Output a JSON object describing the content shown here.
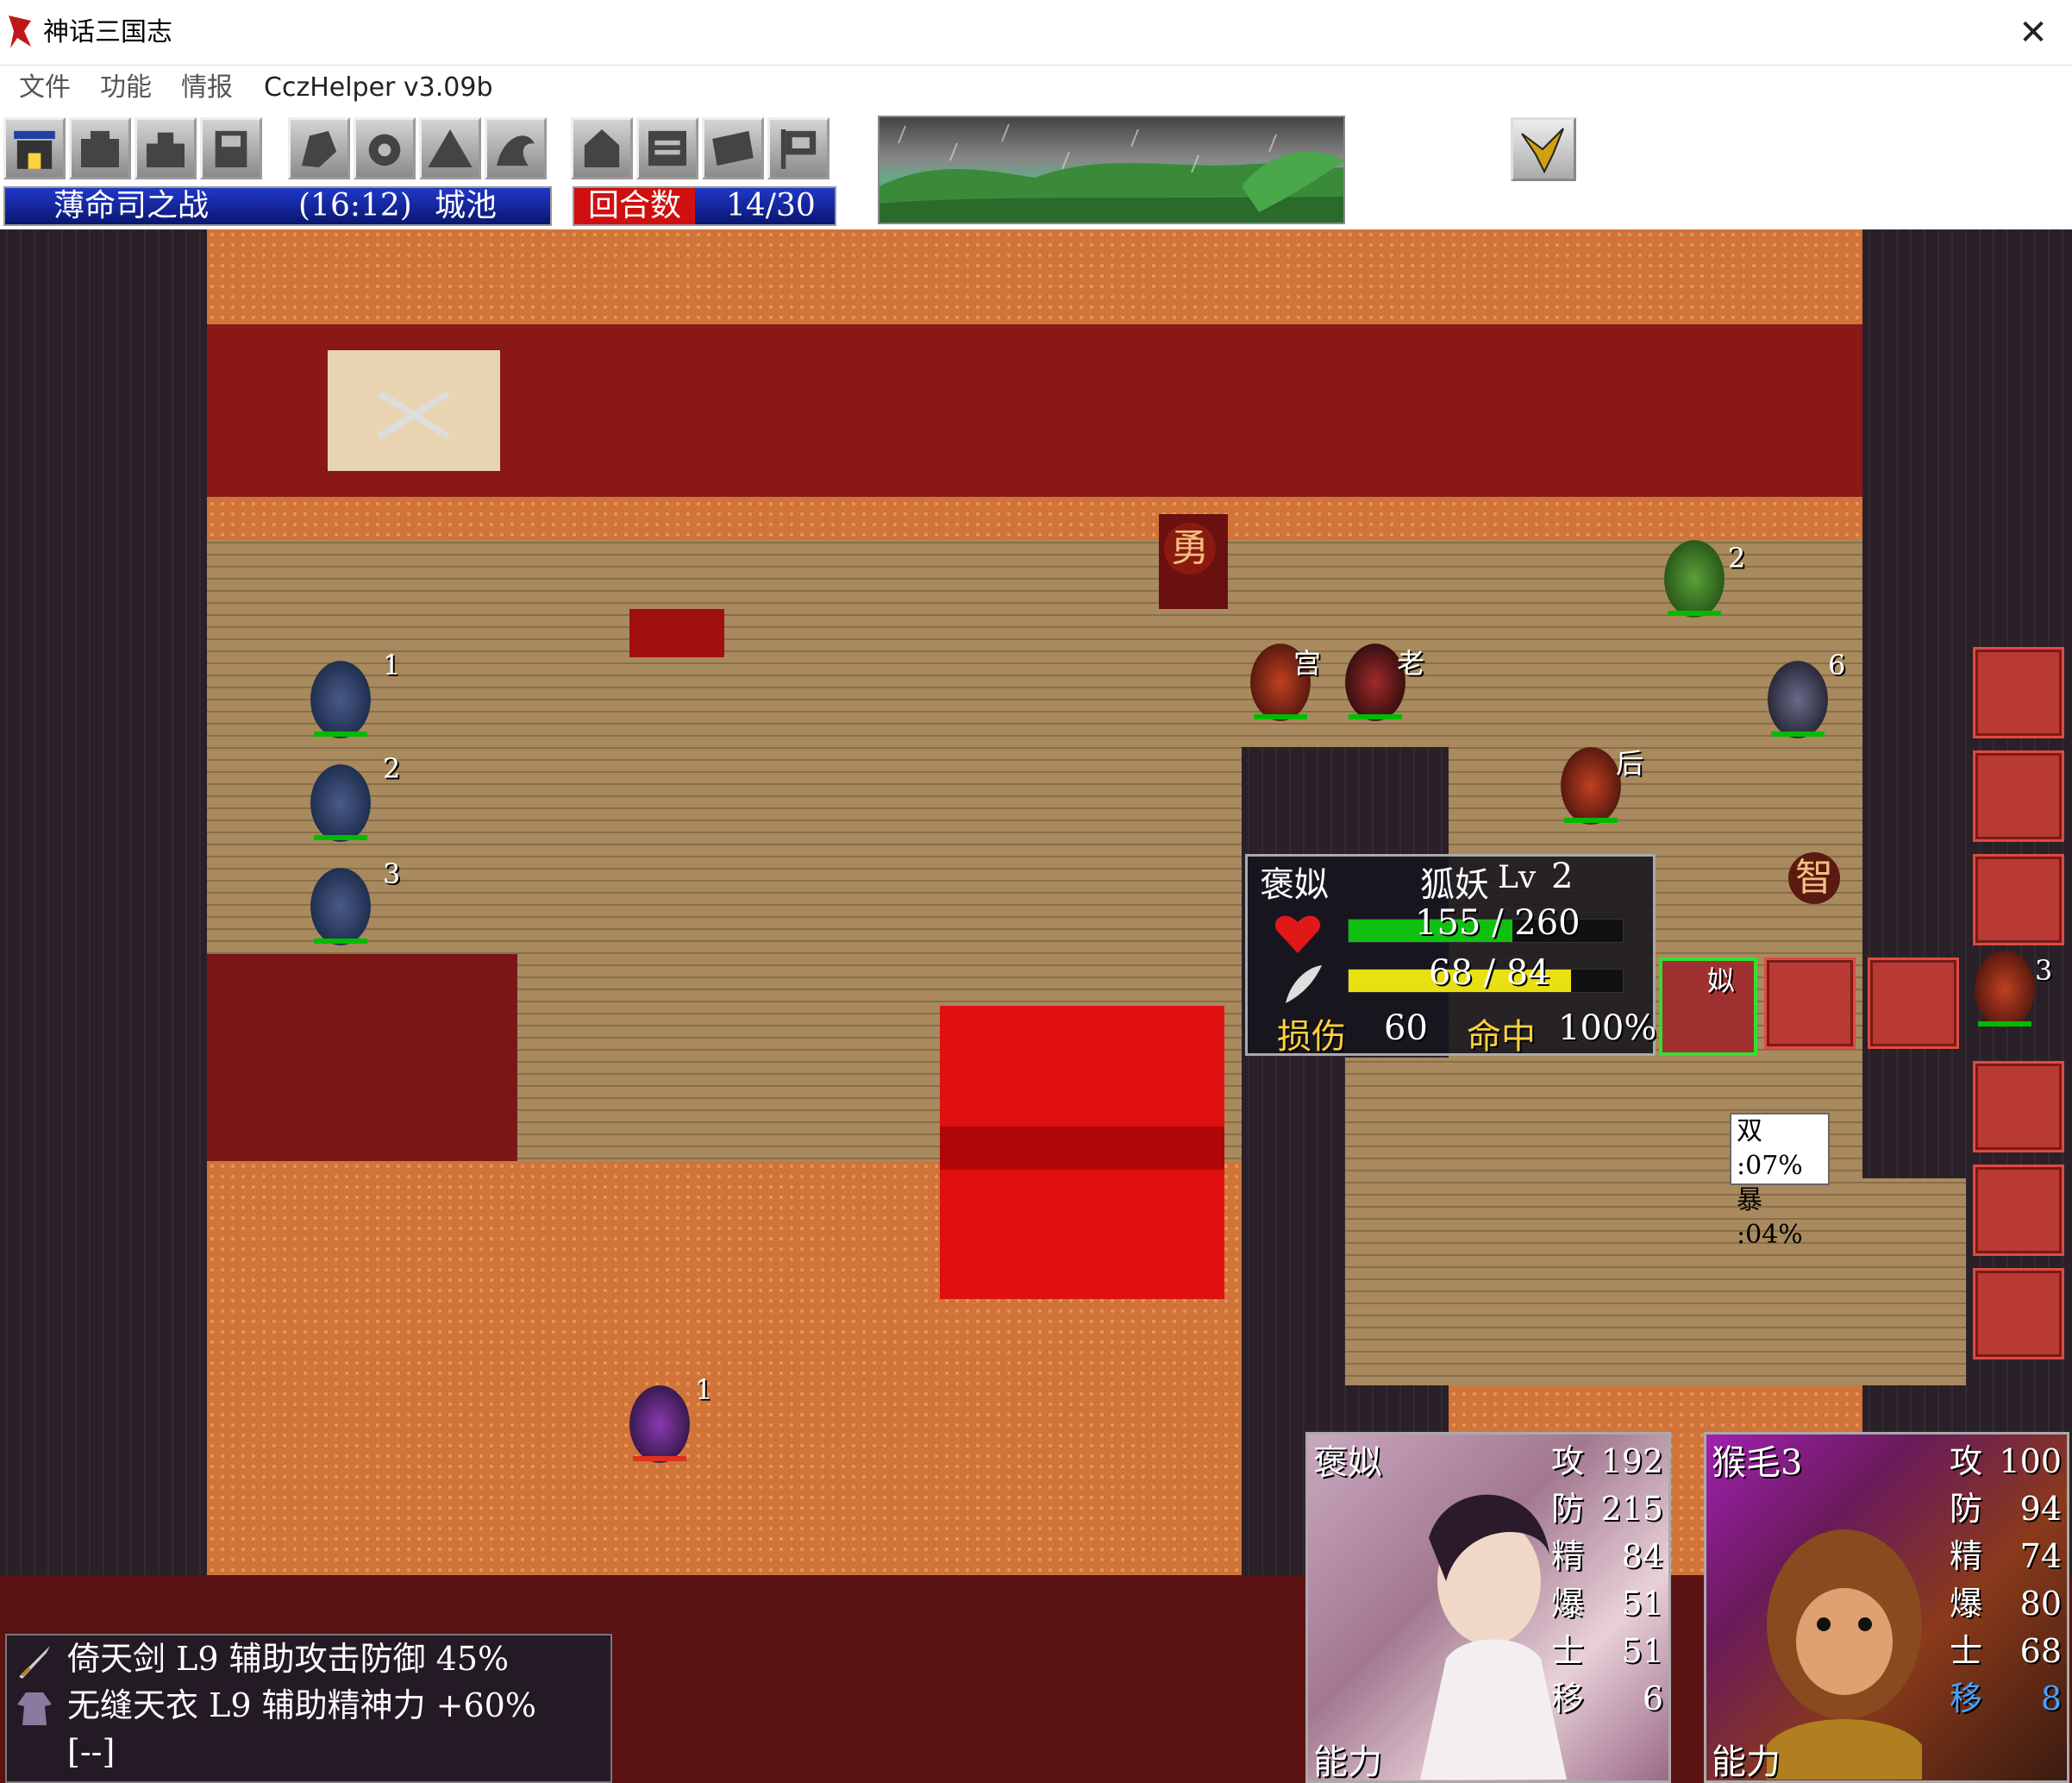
{
  "window": {
    "title": "神话三国志",
    "close_glyph": "✕"
  },
  "menu": [
    {
      "label": "文件"
    },
    {
      "label": "功能"
    },
    {
      "label": "情报"
    },
    {
      "label": "CczHelper v3.09b"
    }
  ],
  "toolbar": {
    "icons": [
      "castle-icon",
      "command-icon",
      "command2-icon",
      "save-icon",
      "unit-icon",
      "strategy-icon",
      "mountain-icon",
      "dragon-icon",
      "home-icon",
      "calendar-icon",
      "scroll-icon",
      "flag-icon"
    ],
    "battle": {
      "name": "薄命司之战",
      "coords": "(16:12)",
      "terrain": "城池"
    },
    "turn": {
      "label": "回合数",
      "value": "14/30"
    },
    "weather": "rain"
  },
  "map": {
    "tile_labels": {
      "brave": "勇",
      "wisdom": "智"
    },
    "unit_numbers": [
      "1",
      "2",
      "3",
      "1",
      "2",
      "6",
      "3"
    ],
    "unit_tags": [
      "宫",
      "老",
      "后",
      "姒"
    ]
  },
  "popup": {
    "name": "褒姒",
    "class": "狐妖",
    "level_label": "Lv",
    "level": "2",
    "hp": "155 / 260",
    "hp_fraction": 0.596,
    "mp": "68 / 84",
    "mp_fraction": 0.81,
    "damage_label": "损伤",
    "damage": "60",
    "hit_label": "命中",
    "hit": "100%"
  },
  "odds": {
    "double": "双 :07%",
    "crit": "暴 :04%"
  },
  "equipment": [
    {
      "icon": "sword-icon",
      "text": "倚天剑  L9  辅助攻击防御  45%"
    },
    {
      "icon": "robe-icon",
      "text": "无缝天衣  L9  辅助精神力  +60%"
    },
    {
      "icon": "",
      "text": "[--]"
    }
  ],
  "cards": [
    {
      "name": "褒姒",
      "footer": "能力",
      "stats": [
        {
          "label": "攻",
          "value": "192"
        },
        {
          "label": "防",
          "value": "215"
        },
        {
          "label": "精",
          "value": "84"
        },
        {
          "label": "爆",
          "value": "51"
        },
        {
          "label": "士",
          "value": "51"
        },
        {
          "label": "移",
          "value": "6"
        }
      ]
    },
    {
      "name": "猴毛3",
      "footer": "能力",
      "stats": [
        {
          "label": "攻",
          "value": "100"
        },
        {
          "label": "防",
          "value": "94"
        },
        {
          "label": "精",
          "value": "74"
        },
        {
          "label": "爆",
          "value": "80"
        },
        {
          "label": "士",
          "value": "68"
        },
        {
          "label": "移",
          "value": "8"
        }
      ]
    }
  ],
  "colors": {
    "hp": "#10c010",
    "mp": "#e8e010",
    "enemy_slot": "#b83a32",
    "accent_gold": "#ffd040"
  }
}
